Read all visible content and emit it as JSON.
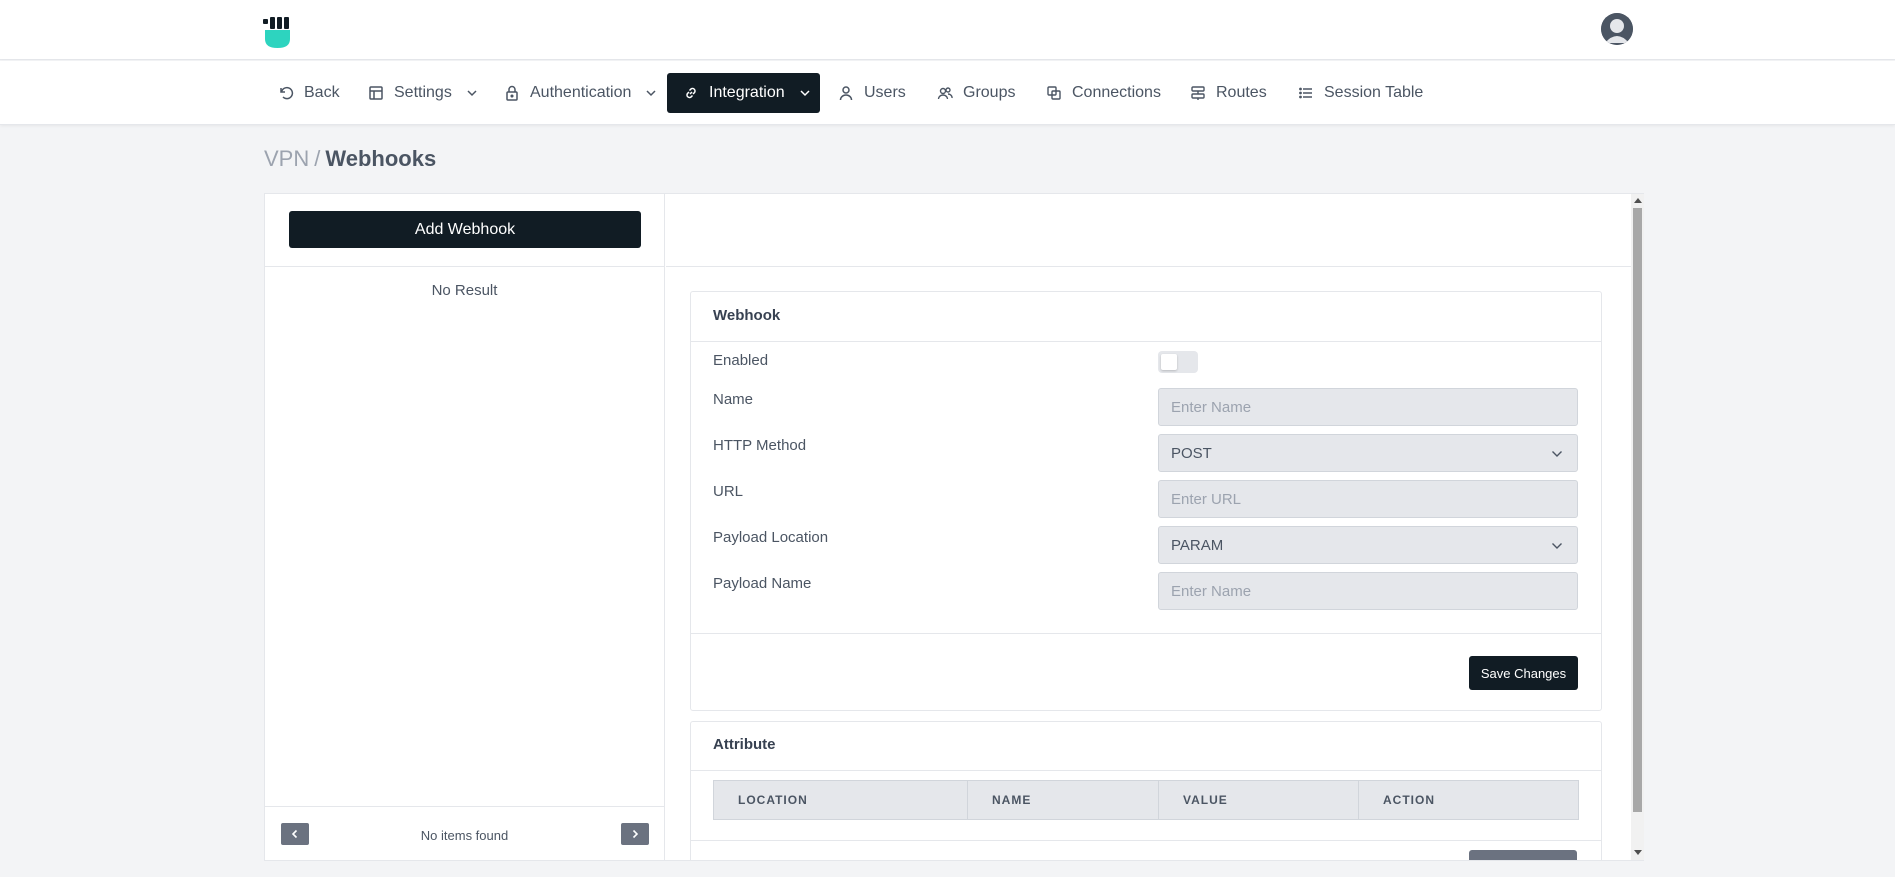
{
  "header": {
    "logo_icon": "fist-logo-icon",
    "avatar_icon": "user-avatar-icon",
    "brand_accent": "#2dd4bf"
  },
  "nav": {
    "items": [
      {
        "label": "Back",
        "icon": "back-arrow-icon"
      },
      {
        "label": "Settings",
        "icon": "layout-icon",
        "dropdown": true
      },
      {
        "label": "Authentication",
        "icon": "lock-icon",
        "dropdown": true
      },
      {
        "label": "Integration",
        "icon": "link-icon",
        "dropdown": true,
        "active": true
      },
      {
        "label": "Users",
        "icon": "user-icon"
      },
      {
        "label": "Groups",
        "icon": "users-icon"
      },
      {
        "label": "Connections",
        "icon": "connections-icon"
      },
      {
        "label": "Routes",
        "icon": "routes-icon"
      },
      {
        "label": "Session Table",
        "icon": "list-icon"
      }
    ],
    "active_color": "#111c24"
  },
  "breadcrumb": {
    "root": "VPN",
    "separator": "/",
    "current": "Webhooks"
  },
  "left": {
    "add_button": "Add Webhook",
    "empty_text": "No Result",
    "pager_text": "No items found"
  },
  "webhook": {
    "title": "Webhook",
    "enabled_label": "Enabled",
    "enabled": false,
    "name_label": "Name",
    "name_placeholder": "Enter Name",
    "method_label": "HTTP Method",
    "method_value": "POST",
    "url_label": "URL",
    "url_placeholder": "Enter URL",
    "payload_location_label": "Payload Location",
    "payload_location_value": "PARAM",
    "payload_name_label": "Payload Name",
    "payload_name_placeholder": "Enter Name",
    "save_button": "Save Changes"
  },
  "attribute": {
    "title": "Attribute",
    "columns": [
      "LOCATION",
      "NAME",
      "VALUE",
      "ACTION"
    ]
  }
}
